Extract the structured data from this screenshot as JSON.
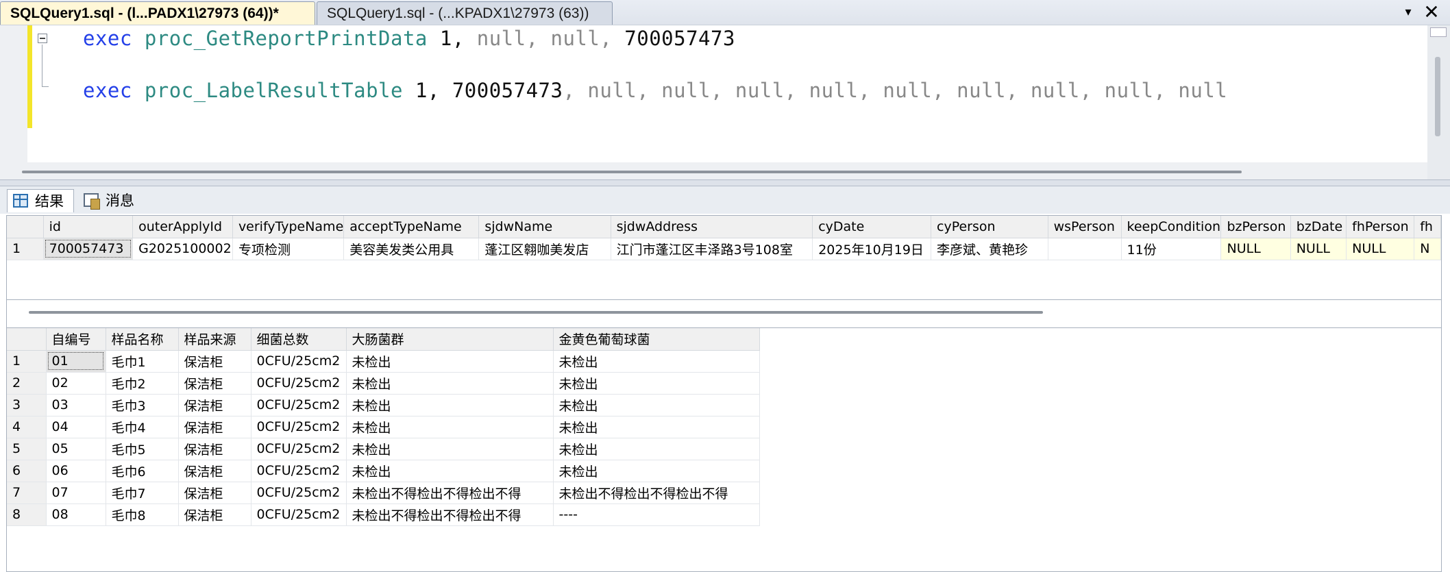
{
  "tabs": [
    {
      "label": "SQLQuery1.sql - (l...PADX1\\27973 (64))*",
      "active": true
    },
    {
      "label": "SQLQuery1.sql - (...KPADX1\\27973 (63))",
      "active": false
    }
  ],
  "tab_controls": {
    "dropdown": "▾",
    "close": "✕"
  },
  "editor": {
    "line1": {
      "kw": "exec",
      "proc": "proc_GetReportPrintData",
      "args_num": "1,",
      "args_null": "null, null,",
      "args_tail": "700057473"
    },
    "line2": {
      "kw": "exec",
      "proc": "proc_LabelResultTable",
      "args_num": "1, 700057473",
      "args_null": ", null, null, null, null, null, null, null, null, null"
    }
  },
  "result_tabs": {
    "results": "结果",
    "messages": "消息"
  },
  "grid1": {
    "columns": [
      "id",
      "outerApplyId",
      "verifyTypeName",
      "acceptTypeName",
      "sjdwName",
      "sjdwAddress",
      "cyDate",
      "cyPerson",
      "wsPerson",
      "keepCondition",
      "bzPerson",
      "bzDate",
      "fhPerson",
      "fh"
    ],
    "rows": [
      [
        "1",
        "700057473",
        "G2025100002",
        "专项检测",
        "美容美发类公用具",
        "蓬江区翱咖美发店",
        "江门市蓬江区丰泽路3号108室",
        "2025年10月19日",
        "李彦斌、黄艳珍",
        "",
        "11份",
        "NULL",
        "NULL",
        "NULL",
        "N"
      ]
    ]
  },
  "grid2": {
    "columns": [
      "自编号",
      "样品名称",
      "样品来源",
      "细菌总数",
      "大肠菌群",
      "金黄色葡萄球菌"
    ],
    "rows": [
      [
        "1",
        "01",
        "毛巾1",
        "保洁柜",
        "0CFU/25cm2",
        "未检出",
        "未检出"
      ],
      [
        "2",
        "02",
        "毛巾2",
        "保洁柜",
        "0CFU/25cm2",
        "未检出",
        "未检出"
      ],
      [
        "3",
        "03",
        "毛巾3",
        "保洁柜",
        "0CFU/25cm2",
        "未检出",
        "未检出"
      ],
      [
        "4",
        "04",
        "毛巾4",
        "保洁柜",
        "0CFU/25cm2",
        "未检出",
        "未检出"
      ],
      [
        "5",
        "05",
        "毛巾5",
        "保洁柜",
        "0CFU/25cm2",
        "未检出",
        "未检出"
      ],
      [
        "6",
        "06",
        "毛巾6",
        "保洁柜",
        "0CFU/25cm2",
        "未检出",
        "未检出"
      ],
      [
        "7",
        "07",
        "毛巾7",
        "保洁柜",
        "0CFU/25cm2",
        "未检出不得检出不得检出不得",
        "未检出不得检出不得检出不得"
      ],
      [
        "8",
        "08",
        "毛巾8",
        "保洁柜",
        "0CFU/25cm2",
        "未检出不得检出不得检出不得",
        "----"
      ]
    ]
  }
}
